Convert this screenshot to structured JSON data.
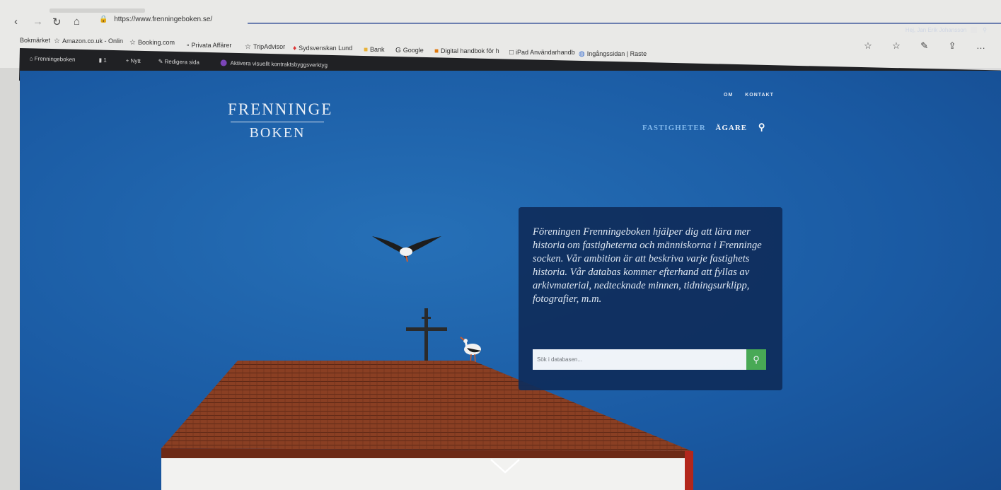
{
  "browser": {
    "url": "https://www.frenningeboken.se/",
    "bookmarks": [
      {
        "label": "Bokmärket",
        "icon": "none"
      },
      {
        "label": "Amazon.co.uk - Onlin",
        "icon": "star-icon"
      },
      {
        "label": "Booking.com",
        "icon": "star-icon"
      },
      {
        "label": "Privata Affärer",
        "icon": "doc-icon"
      },
      {
        "label": "TripAdvisor",
        "icon": "star-icon"
      },
      {
        "label": "Sydsvenskan Lund",
        "icon": "red-icon"
      },
      {
        "label": "Bank",
        "icon": "folder-icon"
      },
      {
        "label": "Google",
        "icon": "google-icon"
      },
      {
        "label": "Digital handbok för h",
        "icon": "orange-icon"
      },
      {
        "label": "iPad Användarhandb",
        "icon": "box-icon"
      },
      {
        "label": "Ingångssidan | Raste",
        "icon": "globe-icon"
      }
    ]
  },
  "admin_bar": {
    "items": [
      "Frenningeboken",
      "1",
      "+ Nytt",
      "Redigera sida",
      "Aktivera visuellt kontraktsbyggsverktyg"
    ],
    "user": "Hej, Jan Erik Johansson"
  },
  "site": {
    "logo_top": "FRENNINGE",
    "logo_bottom": "BOKEN",
    "top_links": [
      "OM",
      "KONTAKT"
    ],
    "nav": [
      "FASTIGHETER",
      "ÄGARE"
    ]
  },
  "hero": {
    "intro": "Föreningen Frenningeboken hjälper dig att lära mer historia om fastigheterna och människorna i Frenninge socken. Vår ambition är att beskriva varje fastighets historia. Vår databas kommer efterhand att fyllas av arkivmaterial, nedtecknade minnen, tidningsurklipp, fotografier, m.m.",
    "search_placeholder": "Sök i databasen..."
  },
  "colors": {
    "sky": "#1a5aa3",
    "box": "#0f2d5c",
    "search_button": "#4caf50",
    "nav_active": "#7fb6ea"
  }
}
